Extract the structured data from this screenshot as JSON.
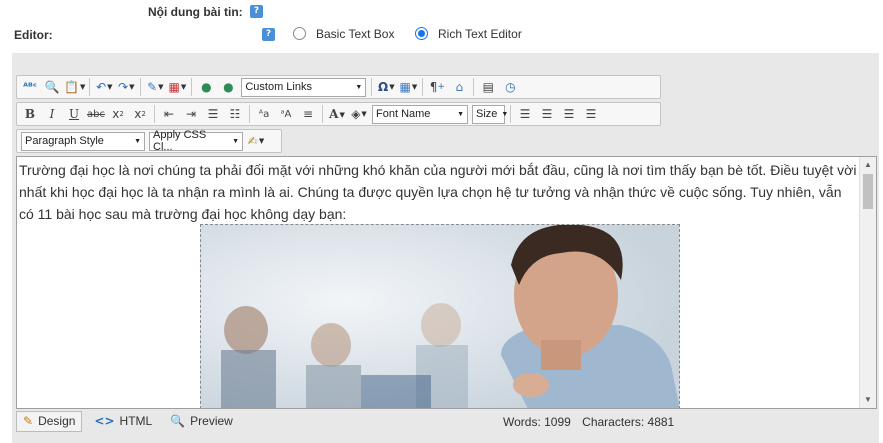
{
  "form": {
    "content_label": "Nội dung bài tin:",
    "editor_label": "Editor:",
    "editor_options": [
      {
        "label": "Basic Text Box",
        "selected": false
      },
      {
        "label": "Rich Text Editor",
        "selected": true
      }
    ]
  },
  "toolbar": {
    "custom_links": "Custom Links",
    "font_name": "Font Name",
    "size": "Size",
    "paragraph_style": "Paragraph Style",
    "apply_css": "Apply CSS Cl..."
  },
  "content": {
    "paragraph": "Trường đại học là nơi chúng ta phải đối mặt với những khó khăn của người mới bắt đầu, cũng là nơi tìm thấy bạn bè tốt. Điều tuyệt vời nhất khi học đại học là ta nhận ra mình là ai. Chúng ta được quyền lựa chọn hệ tư tưởng và nhận thức về cuộc sống. Tuy nhiên, vẫn có 11 bài học sau mà trường đại học không dạy bạn:"
  },
  "modes": {
    "design": "Design",
    "html": "HTML",
    "preview": "Preview"
  },
  "stats": {
    "words": "Words: 1099",
    "characters": "Characters: 4881"
  },
  "colors": {
    "accent": "#1a73e8",
    "help_icon": "#4a90d9",
    "editor_bg": "#e8e8e8"
  }
}
